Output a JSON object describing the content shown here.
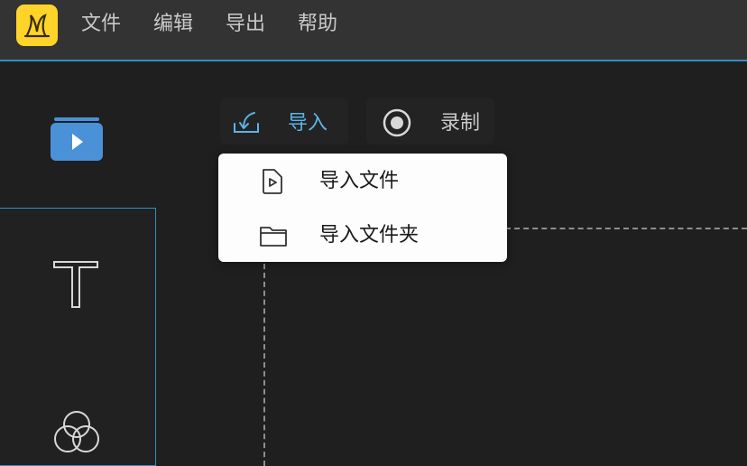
{
  "menubar": {
    "logo_icon": "bee-logo-icon",
    "items": [
      "文件",
      "编辑",
      "导出",
      "帮助"
    ]
  },
  "sidebar": {
    "icons": [
      "media-play-icon",
      "text-icon",
      "filter-circles-icon"
    ]
  },
  "toolbar": {
    "import_label": "导入",
    "record_label": "录制",
    "accent_color": "#5cb3e6"
  },
  "import_menu": {
    "items": [
      {
        "label": "导入文件",
        "icon": "file-video-icon"
      },
      {
        "label": "导入文件夹",
        "icon": "folder-icon"
      }
    ]
  },
  "colors": {
    "menubar_bg": "#333334",
    "main_bg": "#1f1f20",
    "accent": "#2f8fc1",
    "logo_bg": "#ffd42a"
  }
}
